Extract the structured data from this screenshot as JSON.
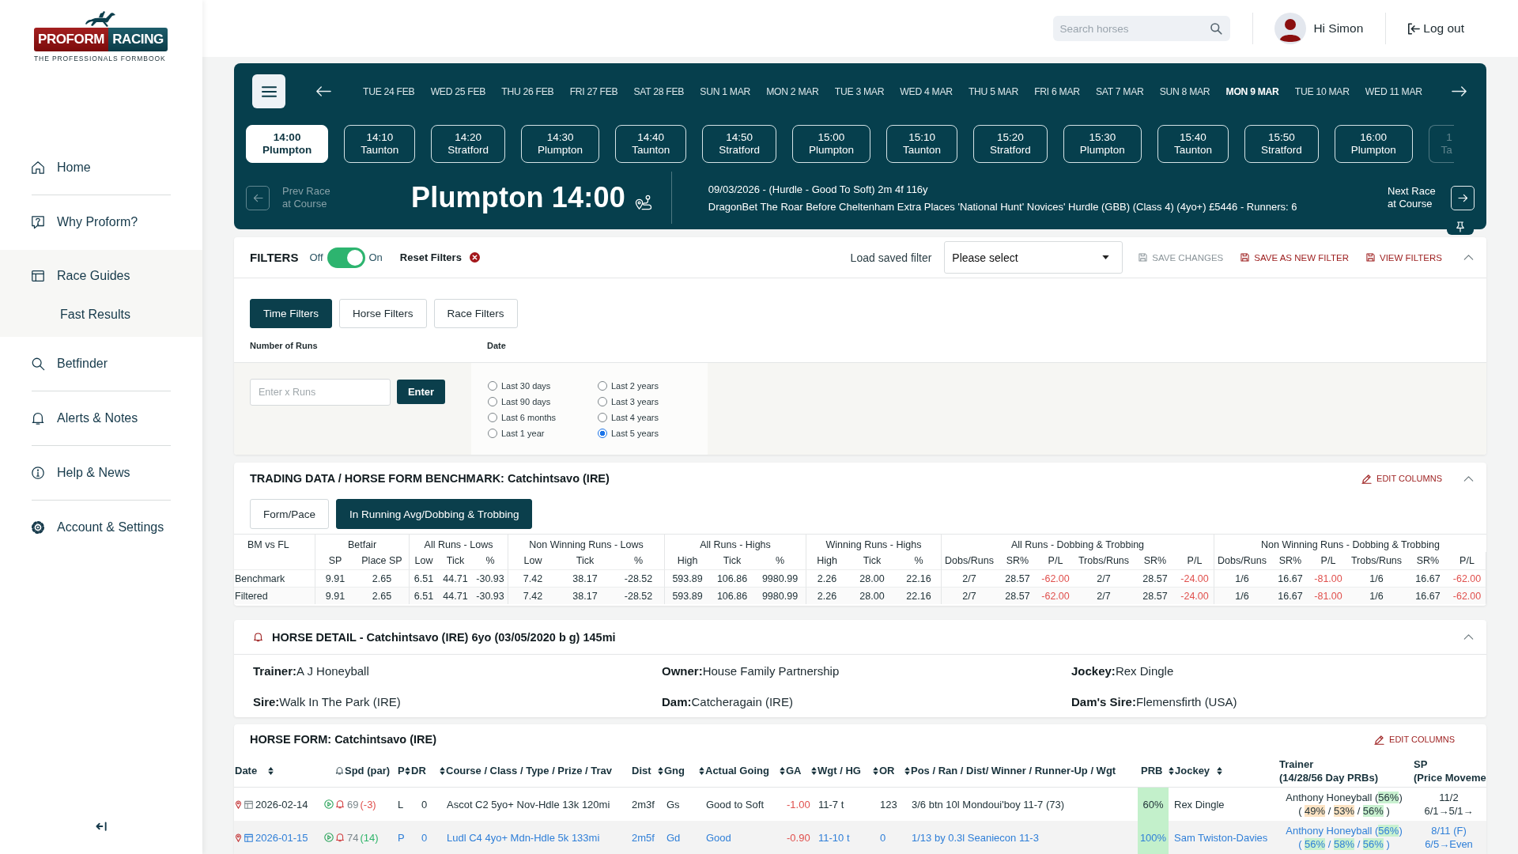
{
  "sidebar": {
    "logo": {
      "word_1": "PROFORM",
      "word_2": "RACING",
      "tagline": "THE PROFESSIONALS FORMBOOK"
    },
    "items": [
      {
        "label": "Home",
        "selected": false
      },
      {
        "label": "Why Proform?",
        "selected": false
      },
      {
        "label": "Race Guides",
        "selected": true,
        "children": [
          {
            "label": "Fast Results",
            "selected": false
          }
        ]
      },
      {
        "label": "Betfinder",
        "selected": false
      },
      {
        "label": "Alerts & Notes",
        "selected": false
      },
      {
        "label": "Help & News",
        "selected": false
      },
      {
        "label": "Account & Settings",
        "selected": false
      }
    ]
  },
  "header": {
    "search": {
      "placeholder": "Search horses"
    },
    "greeting": "Hi Simon",
    "logout": "Log out"
  },
  "race_bar": {
    "dates": [
      {
        "label": "TUE 24 FEB",
        "selected": false
      },
      {
        "label": "WED 25 FEB",
        "selected": false
      },
      {
        "label": "THU 26 FEB",
        "selected": false
      },
      {
        "label": "FRI 27 FEB",
        "selected": false
      },
      {
        "label": "SAT 28 FEB",
        "selected": false
      },
      {
        "label": "SUN 1 MAR",
        "selected": false
      },
      {
        "label": "MON 2 MAR",
        "selected": false
      },
      {
        "label": "TUE 3 MAR",
        "selected": false
      },
      {
        "label": "WED 4 MAR",
        "selected": false
      },
      {
        "label": "THU 5 MAR",
        "selected": false
      },
      {
        "label": "FRI 6 MAR",
        "selected": false
      },
      {
        "label": "SAT 7 MAR",
        "selected": false
      },
      {
        "label": "SUN 8 MAR",
        "selected": false
      },
      {
        "label": "MON 9 MAR",
        "selected": true
      },
      {
        "label": "TUE 10 MAR",
        "selected": false
      },
      {
        "label": "WED 11 MAR",
        "selected": false
      }
    ],
    "races": [
      {
        "time": "14:00",
        "course": "Plumpton",
        "selected": true,
        "faded": false
      },
      {
        "time": "14:10",
        "course": "Taunton",
        "selected": false,
        "faded": false
      },
      {
        "time": "14:20",
        "course": "Stratford",
        "selected": false,
        "faded": false
      },
      {
        "time": "14:30",
        "course": "Plumpton",
        "selected": false,
        "faded": false
      },
      {
        "time": "14:40",
        "course": "Taunton",
        "selected": false,
        "faded": false
      },
      {
        "time": "14:50",
        "course": "Stratford",
        "selected": false,
        "faded": false
      },
      {
        "time": "15:00",
        "course": "Plumpton",
        "selected": false,
        "faded": false
      },
      {
        "time": "15:10",
        "course": "Taunton",
        "selected": false,
        "faded": false
      },
      {
        "time": "15:20",
        "course": "Stratford",
        "selected": false,
        "faded": false
      },
      {
        "time": "15:30",
        "course": "Plumpton",
        "selected": false,
        "faded": false
      },
      {
        "time": "15:40",
        "course": "Taunton",
        "selected": false,
        "faded": false
      },
      {
        "time": "15:50",
        "course": "Stratford",
        "selected": false,
        "faded": false
      },
      {
        "time": "16:00",
        "course": "Plumpton",
        "selected": false,
        "faded": false
      },
      {
        "time": "1",
        "course": "Ta",
        "selected": false,
        "faded": true
      }
    ],
    "prev": "Prev Race at Course",
    "title": "Plumpton 14:00",
    "summary": "09/03/2026 - (Hurdle - Good To Soft) 2m 4f 116y",
    "name": "DragonBet The Roar Before Cheltenham Extra Places 'National Hunt' Novices' Hurdle (GBB) (Class 4) (4yo+) £5446 - Runners: 6",
    "next": "Next Race at Course"
  },
  "filters": {
    "title": "FILTERS",
    "toggle": {
      "off_label": "Off",
      "on_label": "On",
      "on": true
    },
    "reset": "Reset Filters",
    "load_label": "Load saved filter",
    "select": {
      "value": "Please select"
    },
    "actions": [
      {
        "label": "SAVE CHANGES",
        "disabled": true
      },
      {
        "label": "SAVE AS NEW FILTER",
        "disabled": false
      },
      {
        "label": "VIEW FILTERS",
        "disabled": false
      }
    ],
    "tabs": [
      {
        "label": "Time Filters",
        "selected": true
      },
      {
        "label": "Horse Filters",
        "selected": false
      },
      {
        "label": "Race Filters",
        "selected": false
      }
    ],
    "runs": {
      "label": "Number of Runs",
      "placeholder": "Enter x Runs",
      "button": "Enter"
    },
    "date": {
      "label": "Date",
      "options": [
        {
          "label": "Last 30 days",
          "selected": false
        },
        {
          "label": "Last 90 days",
          "selected": false
        },
        {
          "label": "Last 6 months",
          "selected": false
        },
        {
          "label": "Last 1 year",
          "selected": false
        },
        {
          "label": "Last 2 years",
          "selected": false
        },
        {
          "label": "Last 3 years",
          "selected": false
        },
        {
          "label": "Last 4 years",
          "selected": false
        },
        {
          "label": "Last 5 years",
          "selected": true
        }
      ]
    }
  },
  "trading": {
    "title": "TRADING DATA / HORSE FORM BENCHMARK: Catchintsavo (IRE)",
    "edit": "EDIT COLUMNS",
    "tabs": [
      {
        "label": "Form/Pace",
        "selected": false
      },
      {
        "label": "In Running Avg/Dobbing & Trobbing",
        "selected": true
      }
    ],
    "table": {
      "groups": [
        {
          "label": "BM vs FL"
        },
        {
          "label": "Betfair",
          "columns": [
            {
              "label": "SP",
              "kind": "num"
            },
            {
              "label": "Place SP",
              "kind": "num"
            }
          ]
        },
        {
          "label": "All Runs - Lows",
          "columns": [
            {
              "label": "Low",
              "kind": "num"
            },
            {
              "label": "Tick",
              "kind": "num"
            },
            {
              "label": "%",
              "kind": "num"
            }
          ]
        },
        {
          "label": "Non Winning Runs - Lows",
          "columns": [
            {
              "label": "Low",
              "kind": "num"
            },
            {
              "label": "Tick",
              "kind": "num"
            },
            {
              "label": "%",
              "kind": "num"
            }
          ]
        },
        {
          "label": "All Runs - Highs",
          "columns": [
            {
              "label": "High",
              "kind": "num"
            },
            {
              "label": "Tick",
              "kind": "num"
            },
            {
              "label": "%",
              "kind": "num"
            }
          ]
        },
        {
          "label": "Winning Runs - Highs",
          "columns": [
            {
              "label": "High",
              "kind": "num"
            },
            {
              "label": "Tick",
              "kind": "num"
            },
            {
              "label": "%",
              "kind": "num"
            }
          ]
        },
        {
          "label": "All Runs - Dobbing & Trobbing",
          "columns": [
            {
              "label": "Dobs/Runs",
              "kind": "num"
            },
            {
              "label": "SR%",
              "kind": "num"
            },
            {
              "label": "P/L",
              "kind": "pl"
            },
            {
              "label": "Trobs/Runs",
              "kind": "num"
            },
            {
              "label": "SR%",
              "kind": "num"
            },
            {
              "label": "P/L",
              "kind": "pl"
            }
          ]
        },
        {
          "label": "Non Winning Runs - Dobbing & Trobbing",
          "columns": [
            {
              "label": "Dobs/Runs",
              "kind": "num"
            },
            {
              "label": "SR%",
              "kind": "num"
            },
            {
              "label": "P/L",
              "kind": "pl"
            },
            {
              "label": "Trobs/Runs",
              "kind": "num"
            },
            {
              "label": "SR%",
              "kind": "num"
            },
            {
              "label": "P/L",
              "kind": "pl"
            }
          ]
        }
      ],
      "rows": [
        {
          "label": "Benchmark",
          "cells": [
            "9.91",
            "2.65",
            "6.51",
            "44.71",
            "-30.93",
            "7.42",
            "38.17",
            "-28.52",
            "593.89",
            "106.86",
            "9980.99",
            "2.26",
            "28.00",
            "22.16",
            "2/7",
            "28.57",
            "-62.00",
            "2/7",
            "28.57",
            "-24.00",
            "1/6",
            "16.67",
            "-81.00",
            "1/6",
            "16.67",
            "-62.00"
          ]
        },
        {
          "label": "Filtered",
          "cells": [
            "9.91",
            "2.65",
            "6.51",
            "44.71",
            "-30.93",
            "7.42",
            "38.17",
            "-28.52",
            "593.89",
            "106.86",
            "9980.99",
            "2.26",
            "28.00",
            "22.16",
            "2/7",
            "28.57",
            "-62.00",
            "2/7",
            "28.57",
            "-24.00",
            "1/6",
            "16.67",
            "-81.00",
            "1/6",
            "16.67",
            "-62.00"
          ]
        }
      ]
    }
  },
  "horse_detail": {
    "title": "HORSE DETAIL - Catchintsavo (IRE) 6yo (03/05/2020 b g) 145mi",
    "fields": [
      {
        "label": "Trainer:",
        "value": "A J Honeyball"
      },
      {
        "label": "Owner:",
        "value": "House Family Partnership"
      },
      {
        "label": "Jockey:",
        "value": "Rex Dingle"
      },
      {
        "label": "Sire:",
        "value": "Walk In The Park (IRE)"
      },
      {
        "label": "Dam:",
        "value": "Catcheragain (IRE)"
      },
      {
        "label": "Dam's Sire:",
        "value": "Flemensfirth (USA)"
      }
    ]
  },
  "horse_form": {
    "title": "HORSE FORM: Catchintsavo (IRE)",
    "edit": "EDIT COLUMNS",
    "columns": [
      {
        "label": "Date",
        "kind": "sort-after"
      },
      {
        "label": "Spd (par)",
        "kind": "alert"
      },
      {
        "label": "P",
        "kind": "plain"
      },
      {
        "label": "DR",
        "kind": "sort-before"
      },
      {
        "label": "Course / Class / Type / Prize / Trav",
        "kind": "sort-before"
      },
      {
        "label": "Dist",
        "kind": "plain"
      },
      {
        "label": "Gng",
        "kind": "sort-before"
      },
      {
        "label": "Actual Going",
        "kind": "sort-before"
      },
      {
        "label": "GA",
        "kind": "sort-before"
      },
      {
        "label": "Wgt / HG",
        "kind": "sort-before"
      },
      {
        "label": "OR",
        "kind": "sort-before"
      },
      {
        "label": "Pos / Ran / Dist/ Winner / Runner-Up / Wgt",
        "kind": "sort-before"
      },
      {
        "label": "PRB",
        "kind": "plain"
      },
      {
        "label": "Jockey",
        "kind": "sort-both"
      },
      {
        "label": "Trainer",
        "sub": "(14/28/56 Day PRBs)",
        "kind": "plain"
      },
      {
        "label": "SP",
        "sub": "(Price Moveme",
        "kind": "plain"
      }
    ],
    "rows": [
      {
        "highlighted": false,
        "date": "2026-02-14",
        "spd": "69",
        "par": {
          "text": "(-3)",
          "kind": "down"
        },
        "p": "L",
        "dr": "0",
        "course": "Ascot C2 5yo+ Nov-Hdle 13k 120mi",
        "dist": "2m3f",
        "gng": "Gs",
        "going": "Good to Soft",
        "ga": "-1.00",
        "wgt": "11-7 t",
        "or": "123",
        "pos": "3/6 btn 10l Mondoui'boy 11-7 (73)",
        "prb": "60%",
        "jockey": "Rex Dingle",
        "trainer": [
          {
            "text": "Anthony Honeyball (",
            "kind": "plain"
          },
          {
            "text": "56%",
            "kind": "high"
          },
          {
            "text": ")",
            "kind": "plain"
          }
        ],
        "trainer_prbs": [
          {
            "text": "( ",
            "kind": "plain"
          },
          {
            "text": "49%",
            "kind": "mid"
          },
          {
            "text": " / ",
            "kind": "plain"
          },
          {
            "text": "53%",
            "kind": "mid"
          },
          {
            "text": " / ",
            "kind": "plain"
          },
          {
            "text": "56%",
            "kind": "high"
          },
          {
            "text": " )",
            "kind": "plain"
          }
        ],
        "sp": "11/2",
        "sp_moves": "6/1→5/1→"
      },
      {
        "highlighted": true,
        "date": "2026-01-15",
        "spd": "74",
        "par": {
          "text": "(14)",
          "kind": "up"
        },
        "p": "P",
        "dr": "0",
        "course": "Ludl C4 4yo+ Mdn-Hdle 5k 133mi",
        "dist": "2m5f",
        "gng": "Gd",
        "going": "Good",
        "ga": "-0.90",
        "wgt": "11-10 t",
        "or": "0",
        "pos": "1/13 by 0.3l Seaniecon 11-3",
        "prb": "100%",
        "jockey": "Sam Twiston-Davies",
        "trainer": [
          {
            "text": "Anthony Honeyball (",
            "kind": "plain"
          },
          {
            "text": "56%",
            "kind": "high"
          },
          {
            "text": ")",
            "kind": "plain"
          }
        ],
        "trainer_prbs": [
          {
            "text": "( ",
            "kind": "plain"
          },
          {
            "text": "56%",
            "kind": "high"
          },
          {
            "text": " / ",
            "kind": "plain"
          },
          {
            "text": "58%",
            "kind": "high"
          },
          {
            "text": " / ",
            "kind": "plain"
          },
          {
            "text": "56%",
            "kind": "high"
          },
          {
            "text": " )",
            "kind": "plain"
          }
        ],
        "sp": "8/11 (F)",
        "sp_moves": "6/5→Even"
      }
    ]
  }
}
